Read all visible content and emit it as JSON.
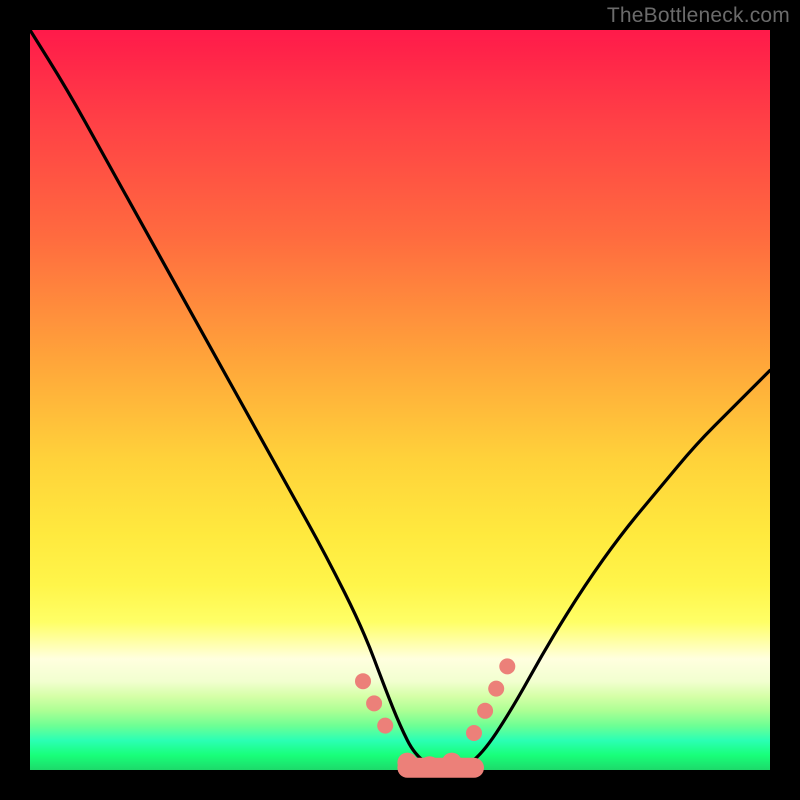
{
  "watermark": "TheBottleneck.com",
  "colors": {
    "frame": "#000000",
    "curve": "#000000",
    "markers": "#ec8079",
    "watermark": "#6b6b6b"
  },
  "chart_data": {
    "type": "line",
    "title": "",
    "xlabel": "",
    "ylabel": "",
    "x": [
      0,
      5,
      10,
      15,
      20,
      25,
      30,
      35,
      40,
      45,
      48,
      50,
      52,
      55,
      58,
      61,
      65,
      70,
      75,
      80,
      85,
      90,
      95,
      100
    ],
    "values": [
      100,
      92,
      83,
      74,
      65,
      56,
      47,
      38,
      29,
      19,
      11,
      6,
      2,
      0,
      0,
      2,
      8,
      17,
      25,
      32,
      38,
      44,
      49,
      54
    ],
    "xlim": [
      0,
      100
    ],
    "ylim": [
      0,
      100
    ],
    "markers": {
      "x": [
        45,
        46.5,
        48,
        51,
        54,
        57,
        60,
        61.5,
        63,
        64.5
      ],
      "y": [
        12,
        9,
        6,
        1,
        0.5,
        1,
        5,
        8,
        11,
        14
      ],
      "size": [
        8,
        8,
        8,
        10,
        10,
        10,
        8,
        8,
        8,
        8
      ]
    },
    "annotations": []
  }
}
